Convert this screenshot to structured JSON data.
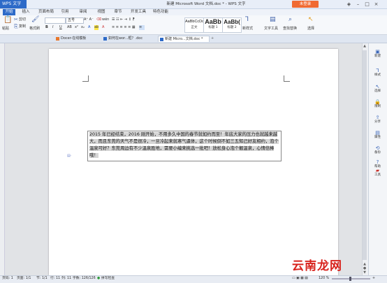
{
  "titlebar": {
    "app_name": "WPS 文字",
    "doc_title": "新建 Microsoft Word 文档.doc * - WPS 文字",
    "login_label": "未登录"
  },
  "menu": [
    "开始",
    "插入",
    "页面布局",
    "引用",
    "审阅",
    "视图",
    "章节",
    "开发工具",
    "特色功能"
  ],
  "ribbon": {
    "paste": "粘贴",
    "cut": "剪切",
    "copy": "复制",
    "format_painter": "格式刷",
    "font_size": "五号",
    "bold": "B",
    "italic": "I",
    "underline": "U",
    "styles": [
      {
        "sample": "AaBbCcDd",
        "name": "正文"
      },
      {
        "sample": "AaBb",
        "name": "标题 1"
      },
      {
        "sample": "AaBb(",
        "name": "标题 2"
      }
    ],
    "new_style": "新样式",
    "text_tools": "文字工具",
    "find_replace": "查找替换",
    "select": "选择"
  },
  "tabs": [
    {
      "label": "Docer-在线模板",
      "active": false
    },
    {
      "label": "如何在wor...框？.doc",
      "active": false
    },
    {
      "label": "新建 Micro...文档.doc *",
      "active": true
    }
  ],
  "document": {
    "paragraph": "2015 年已经结束，2016 刚开始，不用多久中国的春节就如约而至！年底大家的压力也就越来越大，而且东莞的天气不是很冷，一旦冷起来就寒气逼体，这个时候倒不如三五知己好友相约，泡个温泉可好？东莞周边有不少温泉胜地，需要小编来挑选一批吧！放松身心泡个靓温泉，心情倍棒哦！"
  },
  "taskpane": [
    "新建",
    "样式",
    "选择",
    "限制",
    "分享",
    "属性",
    "备份",
    "帮助",
    "工具"
  ],
  "status": {
    "page_num": "页码: 1",
    "pages": "页面: 1/1",
    "section": "节: 1/1",
    "row": "行: 11",
    "col": "列: 11",
    "words": "字数: 126/126",
    "spell": "拼写检查",
    "zoom": "120 %"
  },
  "watermark": "云南龙网",
  "colors": {
    "accent": "#2d6ac8",
    "login": "#f06a32",
    "watermark": "#d8231d"
  }
}
